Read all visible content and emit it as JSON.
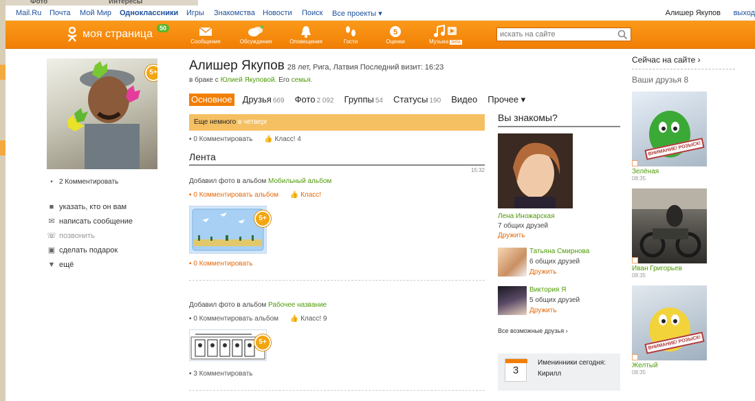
{
  "background_tabs": {
    "tab1": "Фото",
    "tab2": "Интересы"
  },
  "portal": {
    "items": [
      "Mail.Ru",
      "Почта",
      "Мой Мир",
      "Одноклассники",
      "Игры",
      "Знакомства",
      "Новости",
      "Поиск",
      "Все проекты"
    ],
    "user": "Алишер Якупов",
    "exit": "выход"
  },
  "header": {
    "logo": "моя страница",
    "logo_badge": "50",
    "nav": [
      {
        "label": "Сообщения",
        "icon": "envelope-icon"
      },
      {
        "label": "Обсуждения",
        "icon": "speech-bubbles-icon"
      },
      {
        "label": "Оповещения",
        "icon": "bell-icon"
      },
      {
        "label": "Гости",
        "icon": "footprints-icon"
      },
      {
        "label": "Оценки",
        "icon": "rating-five-icon"
      },
      {
        "label": "Музыка",
        "icon": "music-note-icon",
        "badge": "beta"
      }
    ],
    "search_placeholder": "искать на сайте"
  },
  "profile": {
    "name": "Алишер Якупов",
    "info": "28 лет, Рига, Латвия  Последний визит: 16:23",
    "married_prefix": "в браке с",
    "spouse": "Юлией Якуповой.",
    "his": "Его",
    "family": "семья.",
    "avatar_badge": "5+",
    "avatar_comments": "2 Комментировать",
    "left_menu": [
      "указать, кто он вам",
      "написать сообщение",
      "позвонить",
      "сделать подарок",
      "ещё"
    ]
  },
  "tabs": [
    {
      "label": "Основное",
      "count": ""
    },
    {
      "label": "Друзья",
      "count": "669"
    },
    {
      "label": "Фото",
      "count": "2 092"
    },
    {
      "label": "Группы",
      "count": "54"
    },
    {
      "label": "Статусы",
      "count": "190"
    },
    {
      "label": "Видео",
      "count": ""
    },
    {
      "label": "Прочее ▾",
      "count": ""
    }
  ],
  "status": {
    "text": "Еще немного",
    "tail": "в четверг",
    "comments": "0 Комментировать",
    "likes": "Класс! 4"
  },
  "feed": {
    "title": "Лента",
    "time": "15:32",
    "items": [
      {
        "text": "Добавил фото в альбом",
        "album": "Мобильный альбом",
        "c_album": "0 Комментировать альбом",
        "likes": "Класс!",
        "c_photo": "0 Комментировать"
      },
      {
        "text": "Добавил фото в альбом",
        "album": "Рабочее название",
        "c_album": "0 Комментировать альбом",
        "likes": "Класс! 9",
        "c_photo": "3 Комментировать"
      }
    ],
    "thumb_badge": "5+"
  },
  "suggest": {
    "title": "Вы знакомы?",
    "main": {
      "name": "Лена Иножарская",
      "mutual": "7 общих друзей",
      "add": "Дружить"
    },
    "others": [
      {
        "name": "Татьяна Смирнова",
        "mutual": "6 общих друзей",
        "add": "Дружить"
      },
      {
        "name": "Виктория Я",
        "mutual": "5 общих друзей",
        "add": "Дружить"
      }
    ],
    "all": "Все возможные друзья ›"
  },
  "birthday": {
    "day": "3",
    "title": "Именинники сегодня:",
    "name": "Кирилл"
  },
  "online": {
    "title": "Сейчас на сайте ›",
    "friends_label": "Ваши друзья",
    "friends_count": "8",
    "friends": [
      {
        "name": "Зелёная",
        "time": "08:35",
        "wanted": "ВНИМАНИЕ! РОЗЫСК!"
      },
      {
        "name": "Иван Григорьев",
        "time": "08:35",
        "wanted": ""
      },
      {
        "name": "Желтый",
        "time": "08:35",
        "wanted": "ВНИМАНИЕ! РОЗЫСК!"
      }
    ]
  },
  "colors": {
    "brand_orange": "#f17f05",
    "link_green": "#4e9a06",
    "portal_blue": "#1b4f9b"
  }
}
